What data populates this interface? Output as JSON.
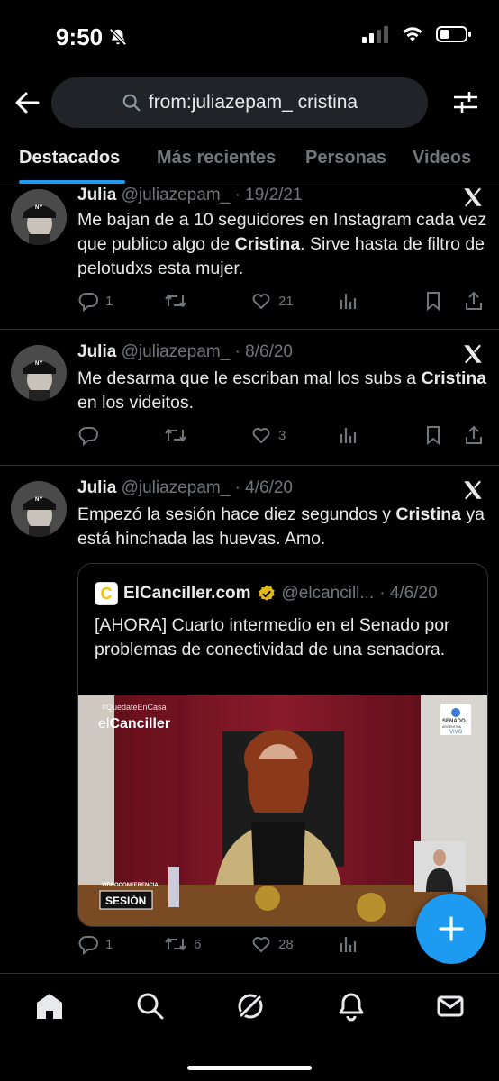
{
  "status_bar": {
    "time": "9:50"
  },
  "search": {
    "query": "from:juliazepam_ cristina"
  },
  "tabs": [
    {
      "label": "Destacados"
    },
    {
      "label": "Más recientes"
    },
    {
      "label": "Personas"
    },
    {
      "label": "Videos"
    }
  ],
  "tweets": [
    {
      "name": "Julia",
      "handle": "@juliazepam_",
      "date": "· 19/2/21",
      "text_parts": [
        "Me bajan de a 10 seguidores en Instagram cada vez que publico algo de ",
        "Cristina",
        ". Sirve hasta de filtro de pelotudxs esta mujer."
      ],
      "replies": "1",
      "retweets": "",
      "likes": "21"
    },
    {
      "name": "Julia",
      "handle": "@juliazepam_",
      "date": "· 8/6/20",
      "text_parts": [
        "Me desarma que le escriban mal los subs a ",
        "Cristina",
        " en los videitos."
      ],
      "replies": "",
      "retweets": "",
      "likes": "3"
    },
    {
      "name": "Julia",
      "handle": "@juliazepam_",
      "date": "· 4/6/20",
      "text_parts": [
        "Empezó la sesión hace diez segundos y ",
        "Cristina",
        " ya está hinchada las huevas. Amo."
      ],
      "replies": "1",
      "retweets": "6",
      "likes": "28",
      "quote": {
        "logo": "C",
        "name": "ElCanciller.com",
        "handle": "@elcancill...",
        "date": "· 4/6/20",
        "text": "[AHORA] Cuarto intermedio en el Senado por problemas de conectividad de una senadora.",
        "media": {
          "hashtag": "#QuedateEnCasa",
          "brand_prefix": "el",
          "brand_name": "Canciller",
          "senado_line1": "SENADO",
          "senado_line2": "ARGENTINA",
          "live": "VIVO",
          "banner_top": "VIDEOCONFERENCIA",
          "banner_main": "SESIÓN"
        }
      }
    }
  ],
  "colors": {
    "accent": "#1d9bf0",
    "text": "#e7e9ea",
    "muted": "#71767b",
    "divider": "#2f3336",
    "verified_gold": "#e2b719"
  }
}
